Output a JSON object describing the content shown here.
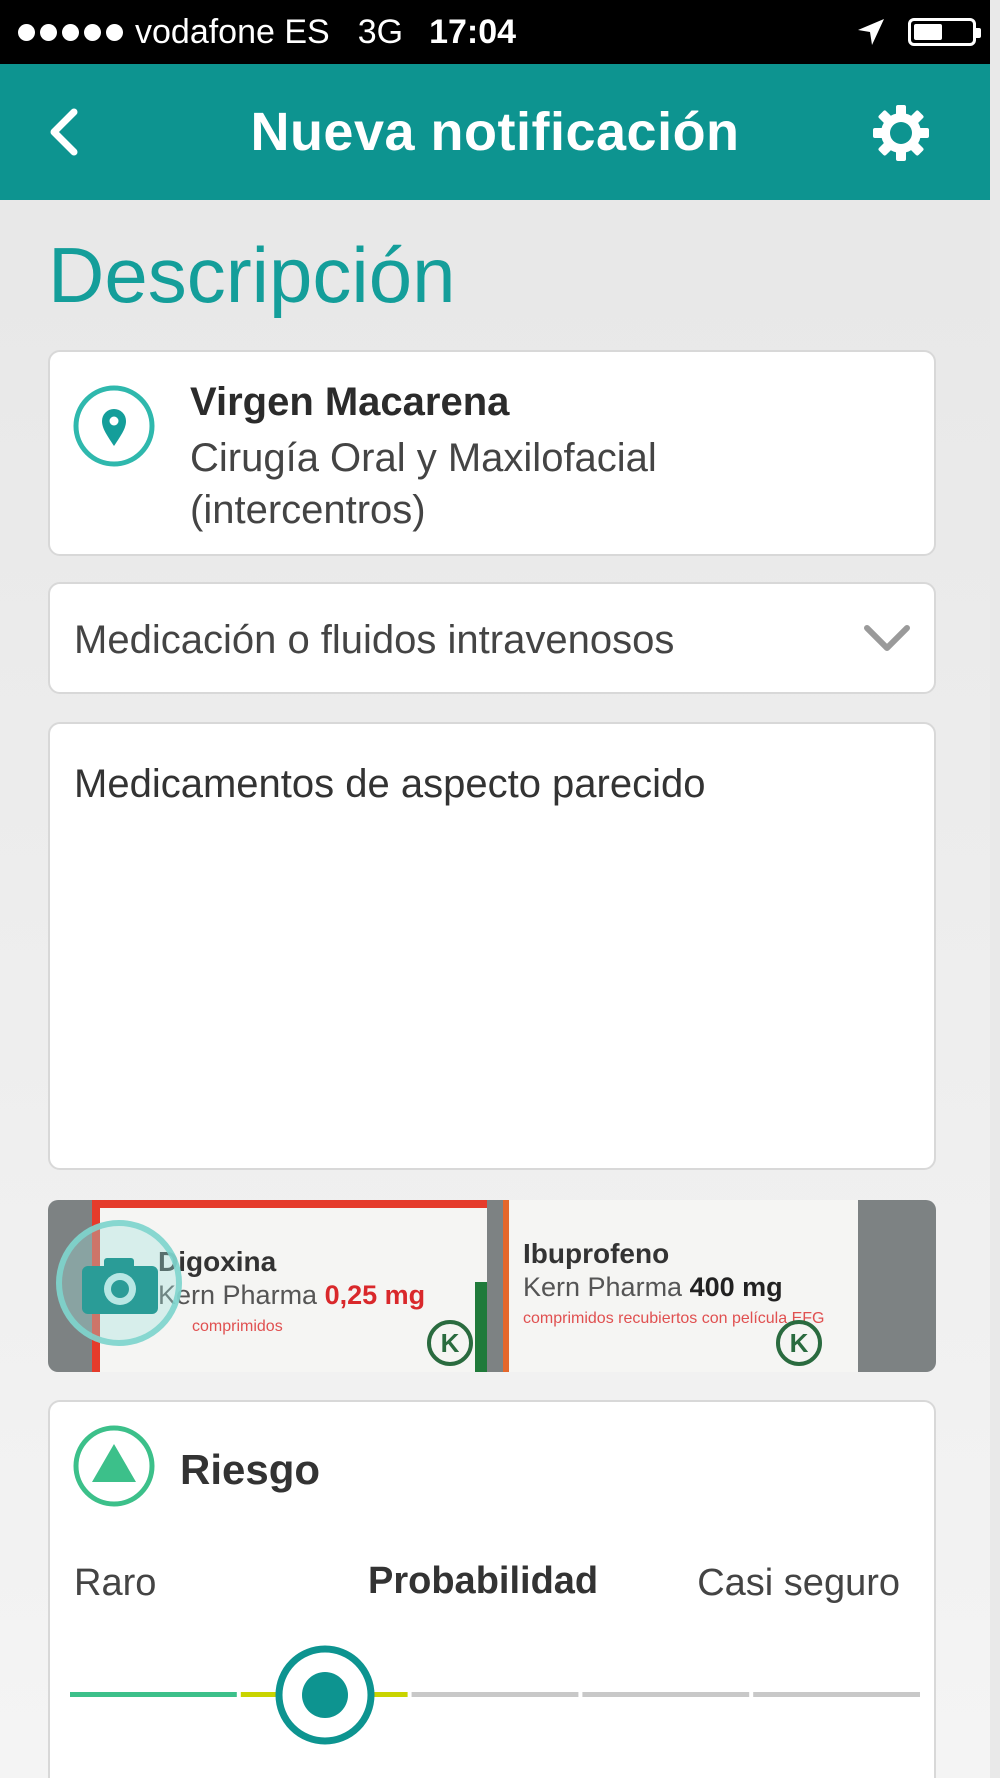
{
  "status_bar": {
    "carrier": "vodafone ES",
    "network": "3G",
    "time": "17:04",
    "icons": [
      "signal-dots-icon",
      "location-arrow-icon",
      "battery-icon"
    ]
  },
  "header": {
    "title": "Nueva notificación",
    "back_icon": "chevron-left-icon",
    "settings_icon": "gear-icon"
  },
  "section_title": "Descripción",
  "location": {
    "name": "Virgen Macarena",
    "detail": "Cirugía Oral y Maxilofacial (intercentros)",
    "icon": "map-pin-icon"
  },
  "category": {
    "value": "Medicación o fluidos intravenosos",
    "icon": "chevron-down-icon"
  },
  "description": {
    "text": "Medicamentos de aspecto parecido"
  },
  "photo": {
    "camera_icon": "camera-icon",
    "box1": {
      "name": "Digoxina",
      "maker": "Kern Pharma",
      "dose": "0,25 mg",
      "note": "comprimidos"
    },
    "box2": {
      "name": "Ibuprofeno",
      "maker": "Kern Pharma",
      "dose": "400 mg",
      "note": "comprimidos recubiertos con película EFG"
    }
  },
  "risk": {
    "title": "Riesgo",
    "icon": "triangle-icon",
    "scale_min": "Raro",
    "scale_label": "Probabilidad",
    "scale_max": "Casi seguro",
    "level_fraction": 0.3,
    "colors": {
      "low": "#3cc08a",
      "current": "#c9d400",
      "track": "#c8c8c8",
      "accent": "#0d9490"
    }
  }
}
